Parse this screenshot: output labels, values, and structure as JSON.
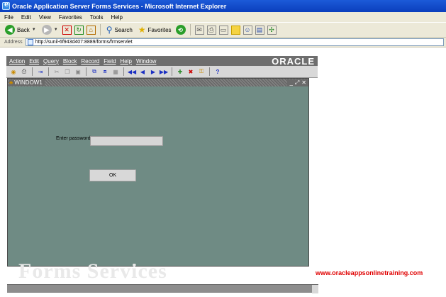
{
  "window": {
    "title": "Oracle Application Server Forms Services - Microsoft Internet Explorer"
  },
  "ie_menu": [
    "File",
    "Edit",
    "View",
    "Favorites",
    "Tools",
    "Help"
  ],
  "ie_toolbar": {
    "back": "Back",
    "search": "Search",
    "favorites": "Favorites"
  },
  "address": {
    "label": "Address",
    "url": "http://sunil-6f943d407:8889/forms/frmservlet"
  },
  "forms_menu": [
    "Action",
    "Edit",
    "Query",
    "Block",
    "Record",
    "Field",
    "Help",
    "Window"
  ],
  "forms_brand": "ORACLE",
  "window1": {
    "title": "WINDOW1"
  },
  "login": {
    "password_label": "Enter password",
    "ok_label": "OK"
  },
  "watermark": "Forms Services",
  "footer": {
    "link": "www.oracleappsonlinetraining.com"
  }
}
